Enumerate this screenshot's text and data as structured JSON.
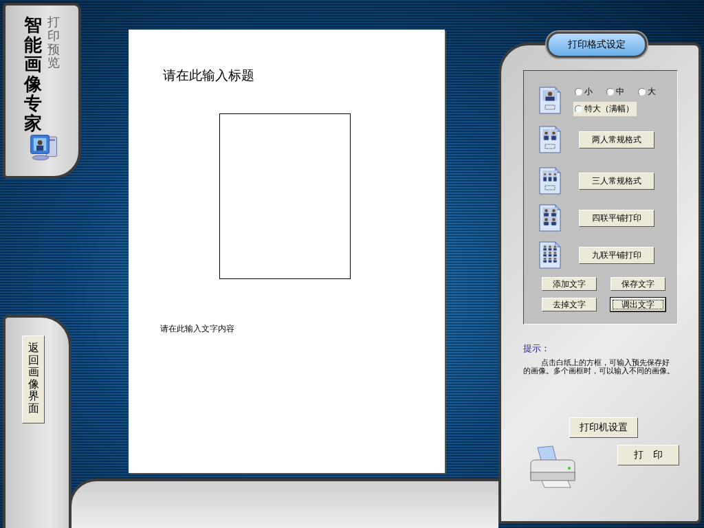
{
  "sidebar": {
    "app_title": "智能画像专家",
    "subtitle": "打印预览"
  },
  "back_button": {
    "label": "返回画像界面"
  },
  "paper": {
    "title_placeholder": "请在此输入标题",
    "text_placeholder": "请在此输入文字内容"
  },
  "format_panel": {
    "title": "打印格式设定",
    "size_options": [
      {
        "label": "小",
        "selected": false
      },
      {
        "label": "中",
        "selected": false
      },
      {
        "label": "大",
        "selected": false
      },
      {
        "label": "特大（满幅）",
        "selected": false
      }
    ],
    "layouts": [
      {
        "kind": "pair",
        "label": "两人常规格式"
      },
      {
        "kind": "triple",
        "label": "三人常规格式"
      },
      {
        "kind": "quad",
        "label": "四联平铺打印"
      },
      {
        "kind": "nine",
        "label": "九联平铺打印"
      }
    ],
    "text_buttons": [
      {
        "label": "添加文字",
        "focused": false
      },
      {
        "label": "保存文字",
        "focused": false
      },
      {
        "label": "去掉文字",
        "focused": false
      },
      {
        "label": "调出文字",
        "focused": true
      }
    ]
  },
  "hint": {
    "label": "提示：",
    "text": "点击白纸上的方框，可输入预先保存好的画像。多个画框时，可以输入不同的画像。"
  },
  "buttons": {
    "printer_setup": "打印机设置",
    "print": "打　印"
  }
}
